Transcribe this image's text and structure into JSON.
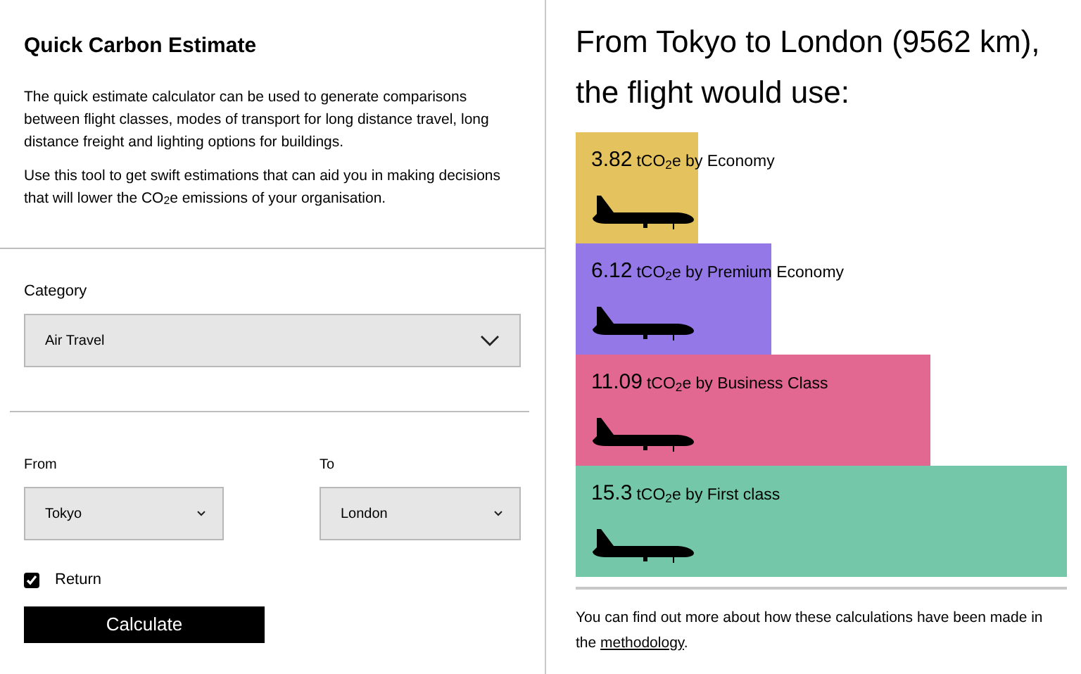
{
  "intro": {
    "title": "Quick Carbon Estimate",
    "paragraphs": [
      "The quick estimate calculator can be used to generate comparisons between flight classes, modes of transport for long distance travel, long distance freight and lighting options for buildings.",
      "Use this tool to get swift estimations that can aid you in making decisions that will lower the CO$_{2}$e emissions of your organisation."
    ]
  },
  "category": {
    "label": "Category",
    "value": "Air Travel"
  },
  "route": {
    "from": {
      "label": "From",
      "value": "Tokyo"
    },
    "to": {
      "label": "To",
      "value": "London"
    }
  },
  "return": {
    "label": "Return",
    "checked": true
  },
  "calculate_button": "Calculate",
  "result": {
    "heading": "From Tokyo to London (9562 km), the flight would use:",
    "classes": [
      {
        "value": "3.82",
        "label": "tCO$_{2}$e by Economy",
        "color": "#e4c35e"
      },
      {
        "value": "6.12",
        "label": "tCO$_{2}$e by Premium Economy",
        "color": "#9478e8"
      },
      {
        "value": "11.09",
        "label": "tCO$_{2}$e by Business Class",
        "color": "#e26791"
      },
      {
        "value": "15.3",
        "label": "tCO$_{2}$e by First class",
        "color": "#74c7a8"
      }
    ],
    "note": "You can find out more about how these calculations have been made in the",
    "link": "methodology",
    "note_end": "."
  }
}
